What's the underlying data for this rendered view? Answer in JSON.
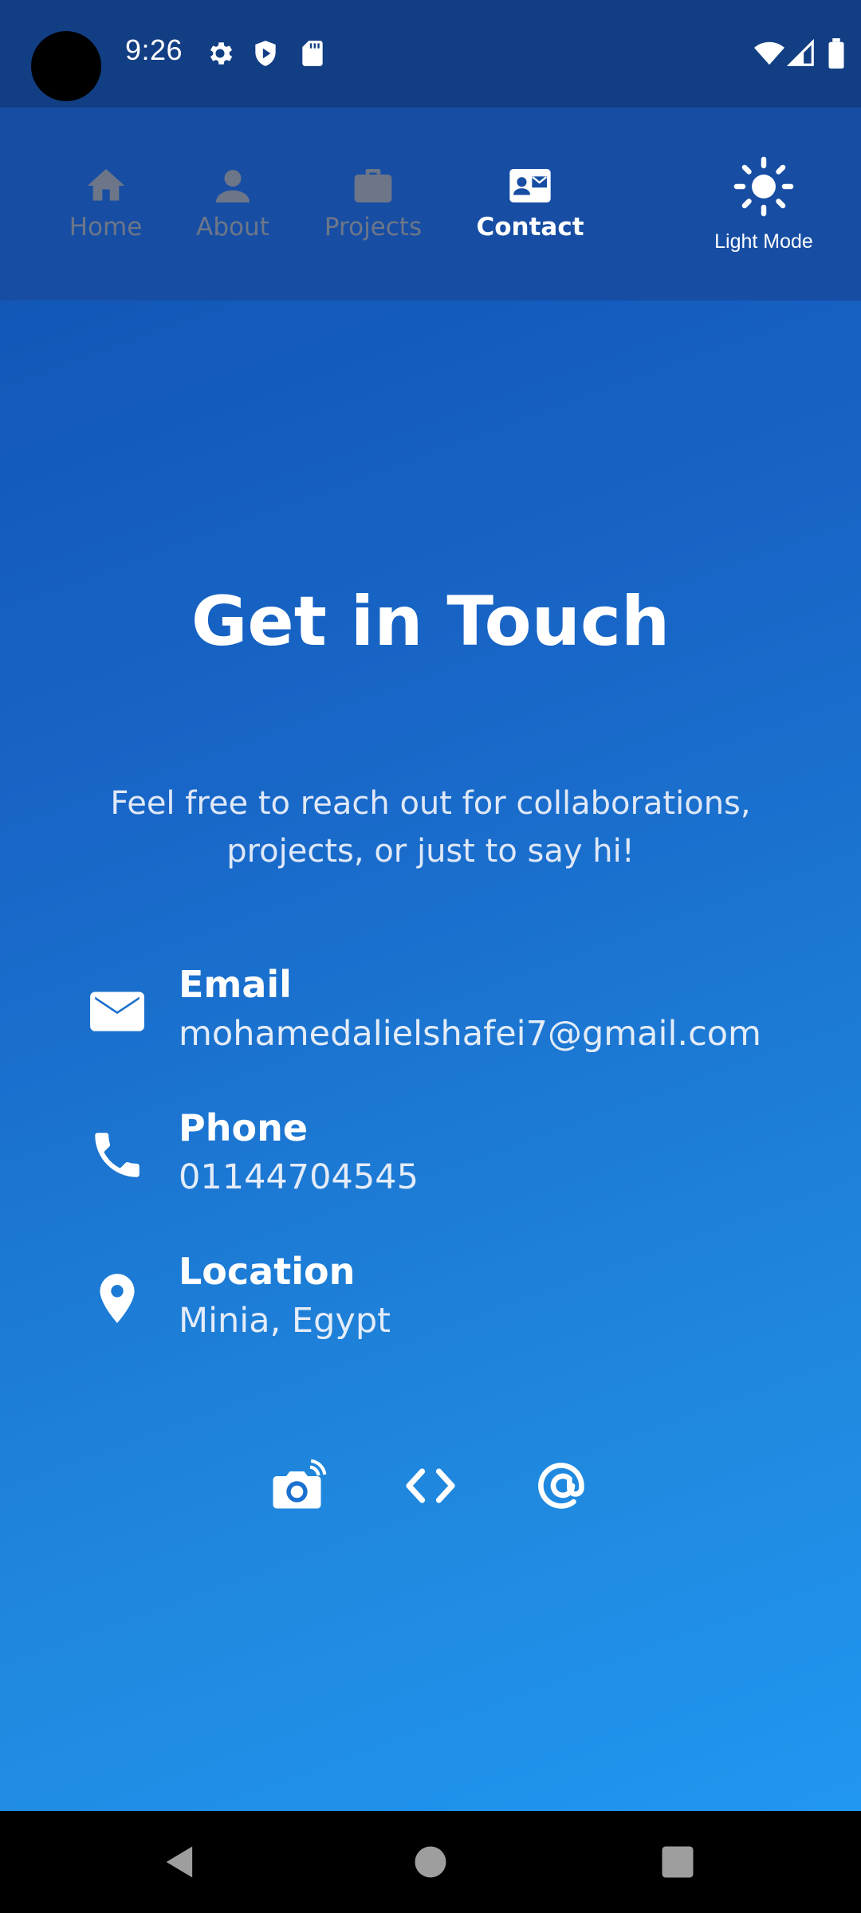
{
  "status_bar": {
    "time": "9:26",
    "icons": [
      "gear-icon",
      "shield-play-icon",
      "sd-card-icon",
      "wifi-icon",
      "signal-icon",
      "battery-icon"
    ]
  },
  "nav": {
    "items": [
      {
        "label": "Home",
        "icon": "home-icon",
        "active": false
      },
      {
        "label": "About",
        "icon": "person-icon",
        "active": false
      },
      {
        "label": "Projects",
        "icon": "briefcase-icon",
        "active": false
      },
      {
        "label": "Contact",
        "icon": "contact-card-icon",
        "active": true
      }
    ],
    "theme_toggle": {
      "label": "Light Mode",
      "icon": "sun-icon"
    }
  },
  "main": {
    "heading": "Get in Touch",
    "subtext": "Feel free to reach out for collaborations, projects, or just to say hi!",
    "contacts": [
      {
        "label": "Email",
        "value": "mohamedalielshafei7@gmail.com",
        "icon": "mail-icon"
      },
      {
        "label": "Phone",
        "value": "01144704545",
        "icon": "phone-icon"
      },
      {
        "label": "Location",
        "value": "Minia, Egypt",
        "icon": "location-pin-icon"
      }
    ],
    "social_icons": [
      "camera-icon",
      "code-icon",
      "at-icon"
    ]
  },
  "system_nav": {
    "buttons": [
      "back-icon",
      "home-circle-icon",
      "recents-icon"
    ]
  },
  "colors": {
    "status_bar": "#123e84",
    "nav_bar": "#174ea4",
    "gradient_top": "#0f4fae",
    "gradient_bottom": "#2196f0",
    "inactive_nav": "#6d7688",
    "text": "#ffffff"
  }
}
